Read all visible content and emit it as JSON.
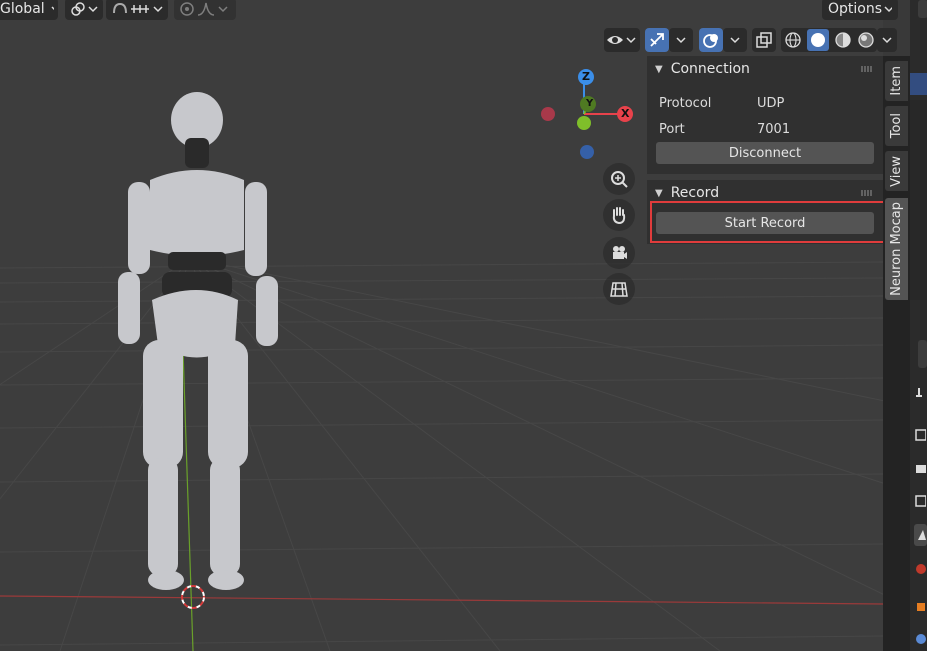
{
  "header": {
    "transform_orientation": "Global",
    "options_label": "Options"
  },
  "gizmo": {
    "z": "Z",
    "y": "Y",
    "x": "X"
  },
  "tabs": [
    "Item",
    "Tool",
    "View",
    "Neuron Mocap"
  ],
  "connection": {
    "title": "Connection",
    "protocol_label": "Protocol",
    "protocol_value": "UDP",
    "port_label": "Port",
    "port_value": "7001",
    "disconnect_label": "Disconnect"
  },
  "record": {
    "title": "Record",
    "start_label": "Start Record"
  },
  "colors": {
    "accent": "#4772b3",
    "highlight": "#e03c3c",
    "x_axis": "#e8424b",
    "y_axis": "#7fbf2a",
    "z_axis": "#3b8ee8"
  }
}
